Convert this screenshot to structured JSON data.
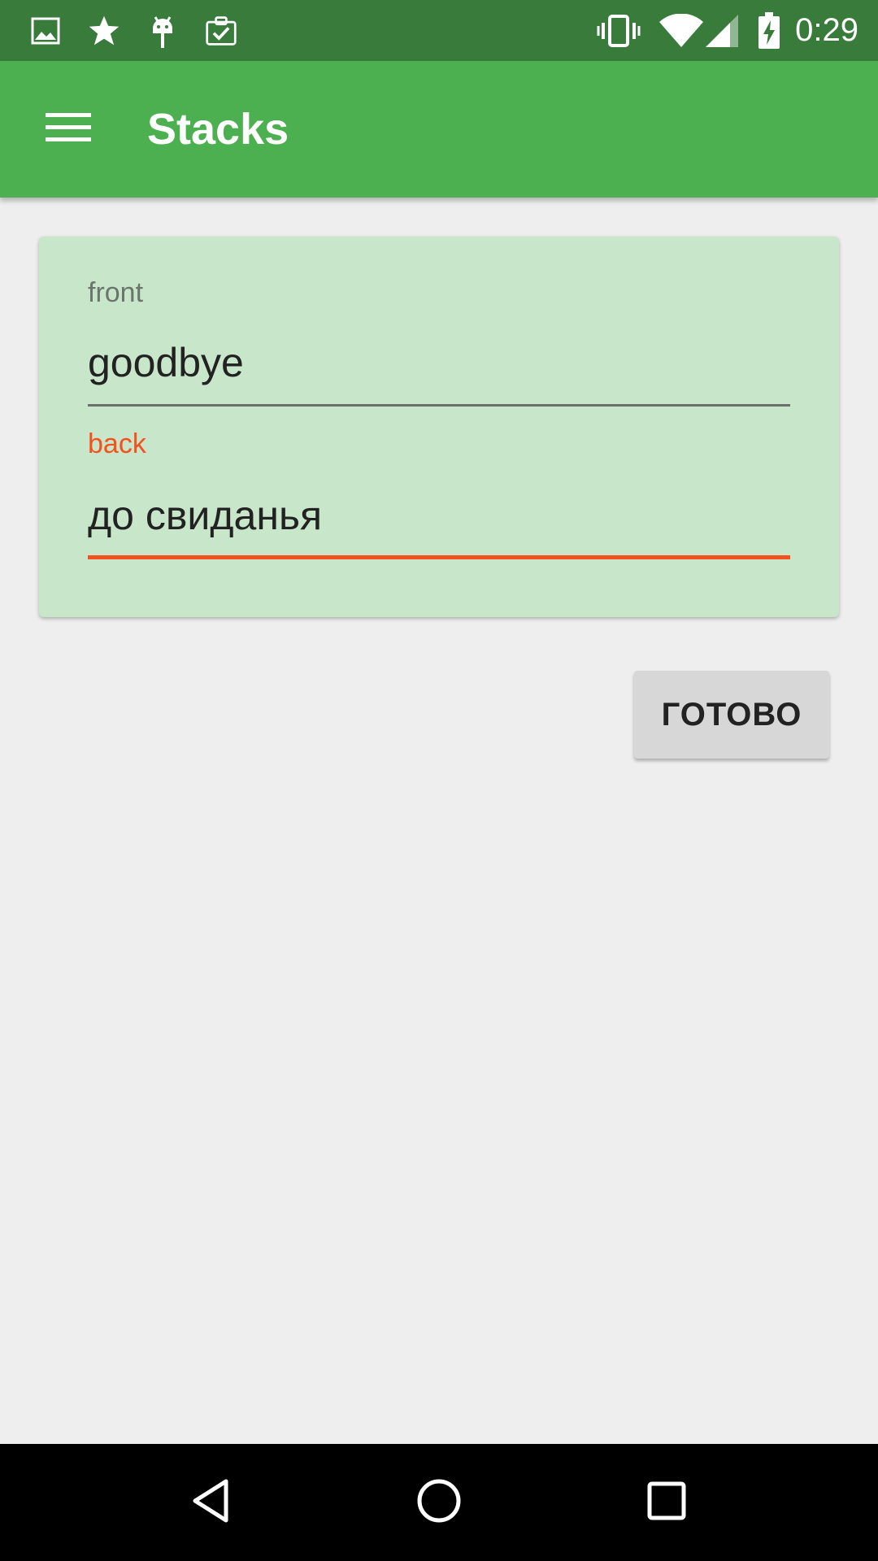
{
  "status_bar": {
    "time": "0:29",
    "left_icons": [
      "image-icon",
      "star-icon",
      "android-icon",
      "clipboard-check-icon"
    ],
    "right_icons": [
      "vibrate-icon",
      "wifi-icon",
      "signal-icon",
      "battery-charging-icon"
    ],
    "background_color": "#387b3b"
  },
  "app_bar": {
    "title": "Stacks",
    "menu_icon": "hamburger-menu-icon",
    "background_color": "#4caf50"
  },
  "card": {
    "background_color": "#c8e6c9",
    "front": {
      "label": "front",
      "value": "goodbye"
    },
    "back": {
      "label": "back",
      "value": "до свиданья",
      "accent_color": "#f4511e"
    }
  },
  "actions": {
    "done_label": "ГОТОВО"
  },
  "nav_bar": {
    "icons": [
      "back-icon",
      "home-icon",
      "recents-icon"
    ]
  }
}
